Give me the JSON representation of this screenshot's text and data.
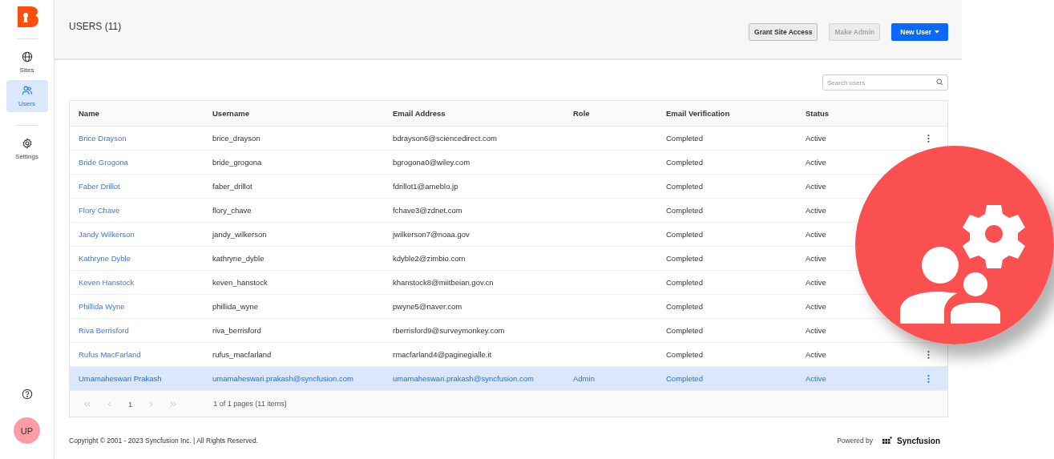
{
  "sidebar": {
    "items": [
      {
        "label": "Sites",
        "selected": false
      },
      {
        "label": "Users",
        "selected": true
      },
      {
        "label": "Settings",
        "selected": false
      }
    ],
    "avatar": {
      "initials": "UP",
      "color": "#fc9ca4"
    }
  },
  "header": {
    "title": "USERS (11)",
    "buttons": [
      {
        "label": "Grant Site Access",
        "kind": "secondary",
        "disabled": false,
        "dropdown": false
      },
      {
        "label": "Make Admin",
        "kind": "secondary",
        "disabled": true,
        "dropdown": false
      },
      {
        "label": "New User",
        "kind": "primary",
        "disabled": false,
        "dropdown": true
      }
    ]
  },
  "search": {
    "placeholder": "Search users"
  },
  "table": {
    "columns": [
      "Name",
      "Username",
      "Email Address",
      "Role",
      "Email Verification",
      "Status"
    ],
    "rows": [
      {
        "name": "Brice Drayson",
        "username": "brice_drayson",
        "email": "bdrayson6@sciencedirect.com",
        "verification": "Completed",
        "status": "Active",
        "selected": false,
        "menu_icon": true
      },
      {
        "name": "Bride Grogona",
        "username": "bride_grogona",
        "email": "bgrogona0@wiley.com",
        "verification": "Completed",
        "status": "Active",
        "selected": false
      },
      {
        "name": "Faber Drillot",
        "username": "faber_drillot",
        "email": "fdrillot1@ameblo.jp",
        "verification": "Completed",
        "status": "Active",
        "selected": false
      },
      {
        "name": "Flory Chave",
        "username": "flory_chave",
        "email": "fchave3@zdnet.com",
        "verification": "Completed",
        "status": "Active",
        "selected": false
      },
      {
        "name": "Jandy Wilkerson",
        "username": "jandy_wilkerson",
        "email": "jwilkerson7@noaa.gov",
        "verification": "Completed",
        "status": "Active",
        "selected": false
      },
      {
        "name": "Kathryne Dyble",
        "username": "kathryne_dyble",
        "email": "kdyble2@zimbio.com",
        "verification": "Completed",
        "status": "Active",
        "selected": false
      },
      {
        "name": "Keven Hanstock",
        "username": "keven_hanstock",
        "email": "khanstock8@miitbeian.gov.cn",
        "verification": "Completed",
        "status": "Active",
        "selected": false
      },
      {
        "name": "Phillida Wyne",
        "username": "phillida_wyne",
        "email": "pwyne5@naver.com",
        "verification": "Completed",
        "status": "Active",
        "selected": false
      },
      {
        "name": "Riva Berrisford",
        "username": "riva_berrisford",
        "email": "rberrisford9@surveymonkey.com",
        "verification": "Completed",
        "status": "Active",
        "selected": false
      },
      {
        "name": "Rufus MacFarland",
        "username": "rufus_macfarland",
        "email": "rmacfarland4@paginegialle.it",
        "verification": "Completed",
        "status": "Active",
        "selected": false,
        "menu_icon": true
      },
      {
        "name": "Umamaheswari Prakash",
        "username": "umamaheswari.prakash@syncfusion.com",
        "email": "umamaheswari.prakash@syncfusion.com",
        "role": "Admin",
        "verification": "Completed",
        "status": "Active",
        "selected": true,
        "menu_icon": true
      }
    ]
  },
  "pager": {
    "page": "1",
    "info": "1 of 1 pages (11 items)"
  },
  "footer": {
    "copyright": "Copyright © 2001 - 2023 Syncfusion Inc. | All Rights Reserved.",
    "powered_by": "Powered by",
    "brand": "Syncfusion"
  }
}
